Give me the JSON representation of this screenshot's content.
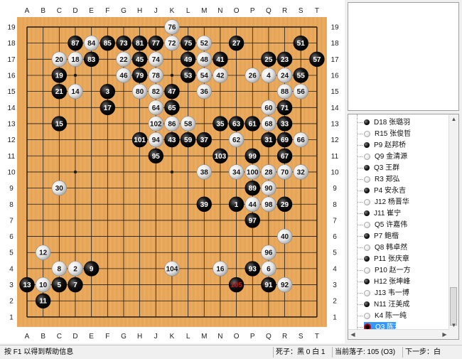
{
  "board": {
    "columns": [
      "A",
      "B",
      "C",
      "D",
      "E",
      "F",
      "G",
      "H",
      "J",
      "K",
      "L",
      "M",
      "N",
      "O",
      "P",
      "Q",
      "R",
      "S",
      "T"
    ],
    "rows": [
      "19",
      "18",
      "17",
      "16",
      "15",
      "14",
      "13",
      "12",
      "11",
      "10",
      "9",
      "8",
      "7",
      "6",
      "5",
      "4",
      "3",
      "2",
      "1"
    ],
    "colors": {
      "wood": "#e8a85c",
      "line": "#1a1a1a",
      "last_move_text": "#d01010"
    },
    "stones": [
      {
        "pt": "K19",
        "c": "w",
        "n": "76"
      },
      {
        "pt": "D18",
        "c": "b",
        "n": "87"
      },
      {
        "pt": "E18",
        "c": "w",
        "n": "84"
      },
      {
        "pt": "F18",
        "c": "b",
        "n": "85"
      },
      {
        "pt": "G18",
        "c": "b",
        "n": "73"
      },
      {
        "pt": "H18",
        "c": "b",
        "n": "81"
      },
      {
        "pt": "J18",
        "c": "b",
        "n": "77"
      },
      {
        "pt": "K18",
        "c": "w",
        "n": "72"
      },
      {
        "pt": "L18",
        "c": "b",
        "n": "75"
      },
      {
        "pt": "M18",
        "c": "w",
        "n": "52"
      },
      {
        "pt": "O18",
        "c": "b",
        "n": "27"
      },
      {
        "pt": "S18",
        "c": "b",
        "n": "51"
      },
      {
        "pt": "C17",
        "c": "w",
        "n": "20"
      },
      {
        "pt": "D17",
        "c": "w",
        "n": "18"
      },
      {
        "pt": "E17",
        "c": "b",
        "n": "83"
      },
      {
        "pt": "G17",
        "c": "w",
        "n": "22"
      },
      {
        "pt": "H17",
        "c": "b",
        "n": "45"
      },
      {
        "pt": "J17",
        "c": "w",
        "n": "74"
      },
      {
        "pt": "L17",
        "c": "b",
        "n": "49"
      },
      {
        "pt": "M17",
        "c": "w",
        "n": "48"
      },
      {
        "pt": "N17",
        "c": "b",
        "n": "41"
      },
      {
        "pt": "Q17",
        "c": "b",
        "n": "25"
      },
      {
        "pt": "R17",
        "c": "b",
        "n": "23"
      },
      {
        "pt": "T17",
        "c": "b",
        "n": "57"
      },
      {
        "pt": "C16",
        "c": "b",
        "n": "19"
      },
      {
        "pt": "G16",
        "c": "w",
        "n": "46"
      },
      {
        "pt": "H16",
        "c": "b",
        "n": "79"
      },
      {
        "pt": "J16",
        "c": "w",
        "n": "78"
      },
      {
        "pt": "L16",
        "c": "b",
        "n": "53"
      },
      {
        "pt": "M16",
        "c": "w",
        "n": "54"
      },
      {
        "pt": "N16",
        "c": "w",
        "n": "42"
      },
      {
        "pt": "P16",
        "c": "w",
        "n": "26"
      },
      {
        "pt": "Q16",
        "c": "w",
        "n": "4"
      },
      {
        "pt": "R16",
        "c": "w",
        "n": "24"
      },
      {
        "pt": "S16",
        "c": "b",
        "n": "55"
      },
      {
        "pt": "C15",
        "c": "b",
        "n": "21"
      },
      {
        "pt": "D15",
        "c": "w",
        "n": "14"
      },
      {
        "pt": "F15",
        "c": "b",
        "n": "3"
      },
      {
        "pt": "H15",
        "c": "w",
        "n": "80"
      },
      {
        "pt": "J15",
        "c": "w",
        "n": "82"
      },
      {
        "pt": "K15",
        "c": "b",
        "n": "47"
      },
      {
        "pt": "M15",
        "c": "w",
        "n": "36"
      },
      {
        "pt": "R15",
        "c": "w",
        "n": "88"
      },
      {
        "pt": "S15",
        "c": "w",
        "n": "56"
      },
      {
        "pt": "F14",
        "c": "b",
        "n": "17"
      },
      {
        "pt": "J14",
        "c": "w",
        "n": "64"
      },
      {
        "pt": "K14",
        "c": "b",
        "n": "65"
      },
      {
        "pt": "Q14",
        "c": "w",
        "n": "60"
      },
      {
        "pt": "R14",
        "c": "b",
        "n": "71"
      },
      {
        "pt": "C13",
        "c": "b",
        "n": "15"
      },
      {
        "pt": "J13",
        "c": "w",
        "n": "102"
      },
      {
        "pt": "K13",
        "c": "w",
        "n": "86"
      },
      {
        "pt": "L13",
        "c": "w",
        "n": "58"
      },
      {
        "pt": "N13",
        "c": "b",
        "n": "35"
      },
      {
        "pt": "O13",
        "c": "b",
        "n": "63"
      },
      {
        "pt": "P13",
        "c": "b",
        "n": "61"
      },
      {
        "pt": "Q13",
        "c": "w",
        "n": "68"
      },
      {
        "pt": "R13",
        "c": "b",
        "n": "33"
      },
      {
        "pt": "H12",
        "c": "b",
        "n": "101"
      },
      {
        "pt": "J12",
        "c": "w",
        "n": "94"
      },
      {
        "pt": "K12",
        "c": "b",
        "n": "43"
      },
      {
        "pt": "L12",
        "c": "b",
        "n": "59"
      },
      {
        "pt": "M12",
        "c": "b",
        "n": "37"
      },
      {
        "pt": "O12",
        "c": "w",
        "n": "62"
      },
      {
        "pt": "Q12",
        "c": "b",
        "n": "31"
      },
      {
        "pt": "R12",
        "c": "b",
        "n": "69"
      },
      {
        "pt": "S12",
        "c": "w",
        "n": "66"
      },
      {
        "pt": "J11",
        "c": "b",
        "n": "95"
      },
      {
        "pt": "N11",
        "c": "b",
        "n": "103"
      },
      {
        "pt": "P11",
        "c": "b",
        "n": "99"
      },
      {
        "pt": "R11",
        "c": "b",
        "n": "67"
      },
      {
        "pt": "M10",
        "c": "w",
        "n": "38"
      },
      {
        "pt": "O10",
        "c": "w",
        "n": "34"
      },
      {
        "pt": "P10",
        "c": "w",
        "n": "100"
      },
      {
        "pt": "Q10",
        "c": "w",
        "n": "28"
      },
      {
        "pt": "R10",
        "c": "w",
        "n": "70"
      },
      {
        "pt": "S10",
        "c": "w",
        "n": "32"
      },
      {
        "pt": "C9",
        "c": "w",
        "n": "30"
      },
      {
        "pt": "P9",
        "c": "b",
        "n": "89"
      },
      {
        "pt": "Q9",
        "c": "w",
        "n": "90"
      },
      {
        "pt": "M8",
        "c": "b",
        "n": "39"
      },
      {
        "pt": "O8",
        "c": "b",
        "n": "1"
      },
      {
        "pt": "P8",
        "c": "w",
        "n": "44"
      },
      {
        "pt": "Q8",
        "c": "w",
        "n": "98"
      },
      {
        "pt": "R8",
        "c": "b",
        "n": "29"
      },
      {
        "pt": "P7",
        "c": "b",
        "n": "97"
      },
      {
        "pt": "R6",
        "c": "w",
        "n": "40"
      },
      {
        "pt": "B5",
        "c": "w",
        "n": "12"
      },
      {
        "pt": "Q5",
        "c": "w",
        "n": "96"
      },
      {
        "pt": "C4",
        "c": "w",
        "n": "8"
      },
      {
        "pt": "D4",
        "c": "w",
        "n": "2"
      },
      {
        "pt": "E4",
        "c": "b",
        "n": "9"
      },
      {
        "pt": "K4",
        "c": "w",
        "n": "104"
      },
      {
        "pt": "N4",
        "c": "w",
        "n": "16"
      },
      {
        "pt": "P4",
        "c": "b",
        "n": "93"
      },
      {
        "pt": "Q4",
        "c": "w",
        "n": "6"
      },
      {
        "pt": "A3",
        "c": "b",
        "n": "13"
      },
      {
        "pt": "B3",
        "c": "w",
        "n": "10"
      },
      {
        "pt": "C3",
        "c": "b",
        "n": "5"
      },
      {
        "pt": "D3",
        "c": "b",
        "n": "7"
      },
      {
        "pt": "O3",
        "c": "b",
        "n": "105",
        "last": true
      },
      {
        "pt": "Q3",
        "c": "b",
        "n": "91"
      },
      {
        "pt": "R3",
        "c": "w",
        "n": "92"
      },
      {
        "pt": "B2",
        "c": "b",
        "n": "11"
      }
    ]
  },
  "move_list": [
    {
      "c": "b",
      "text": "D18 张璐羽"
    },
    {
      "c": "w",
      "text": "R15 张俊哲"
    },
    {
      "c": "b",
      "text": "P9 赵邦桥"
    },
    {
      "c": "w",
      "text": "Q9 金清源"
    },
    {
      "c": "b",
      "text": "Q3 王群"
    },
    {
      "c": "w",
      "text": "R3 郑弘"
    },
    {
      "c": "b",
      "text": "P4 安永吉"
    },
    {
      "c": "w",
      "text": "J12 杨晋华"
    },
    {
      "c": "b",
      "text": "J11 崔宁"
    },
    {
      "c": "w",
      "text": "Q5 许嘉伟"
    },
    {
      "c": "b",
      "text": "P7 鲍楷"
    },
    {
      "c": "w",
      "text": "Q8 韩卓然"
    },
    {
      "c": "b",
      "text": "P11 张庆章"
    },
    {
      "c": "w",
      "text": "P10 赵一方"
    },
    {
      "c": "b",
      "text": "H12 张坤峰"
    },
    {
      "c": "w",
      "text": "J13 韦一博"
    },
    {
      "c": "b",
      "text": "N11 汪美成"
    },
    {
      "c": "w",
      "text": "K4 陈一纯"
    },
    {
      "c": "current",
      "text": "O3 陈玄",
      "selected": true
    }
  ],
  "status": {
    "help": "按 F1 以得到帮助信息",
    "captures": "死子：黑 0 白 1",
    "current_move": "当前落子: 105 (O3)",
    "next_move": "下一步：白"
  }
}
